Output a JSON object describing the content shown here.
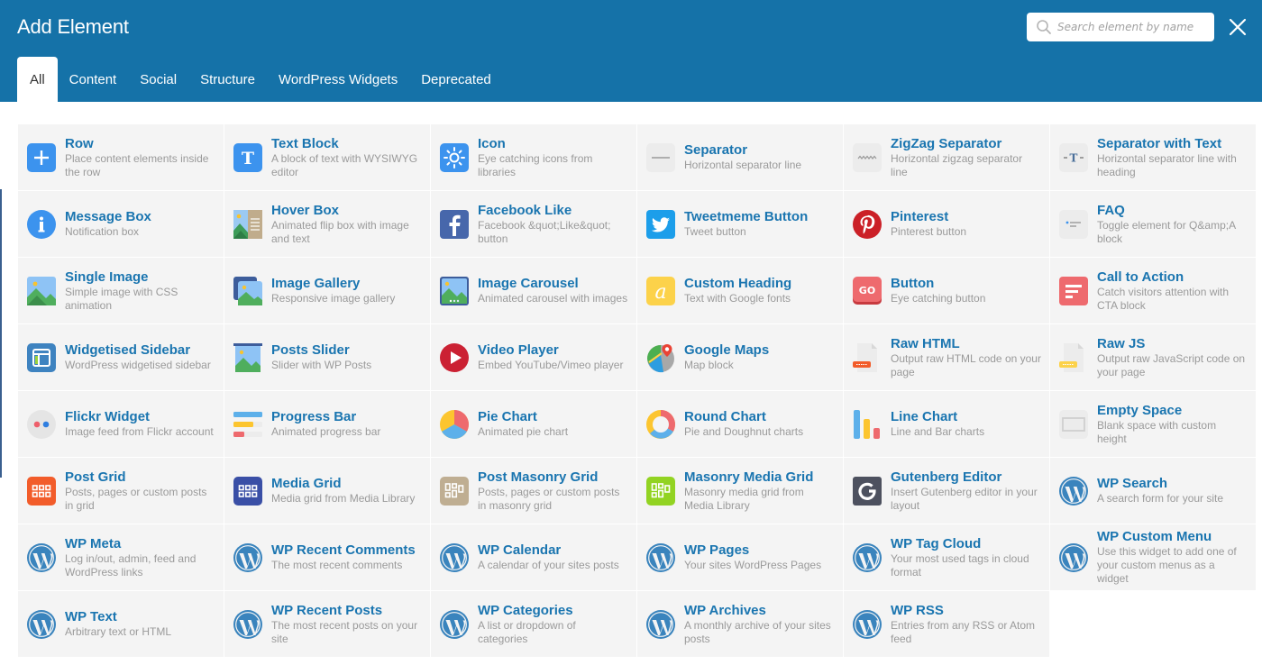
{
  "header": {
    "title": "Add Element",
    "search_placeholder": "Search element by name",
    "search_value": "",
    "search_icon": "search-icon",
    "close_icon": "close-icon"
  },
  "tabs": [
    {
      "label": "All",
      "active": true
    },
    {
      "label": "Content",
      "active": false
    },
    {
      "label": "Social",
      "active": false
    },
    {
      "label": "Structure",
      "active": false
    },
    {
      "label": "WordPress Widgets",
      "active": false
    },
    {
      "label": "Deprecated",
      "active": false
    }
  ],
  "colors": {
    "header_bg": "#1572a8",
    "title_text": "#1a75b0",
    "desc_text": "#9a9a9a",
    "cell_bg": "#f4f4f4"
  },
  "elements": [
    {
      "name": "Row",
      "desc": "Place content elements inside the row",
      "icon": "plus-icon"
    },
    {
      "name": "Text Block",
      "desc": "A block of text with WYSIWYG editor",
      "icon": "text-t-icon"
    },
    {
      "name": "Icon",
      "desc": "Eye catching icons from libraries",
      "icon": "sun-icon"
    },
    {
      "name": "Separator",
      "desc": "Horizontal separator line",
      "icon": "separator-icon"
    },
    {
      "name": "ZigZag Separator",
      "desc": "Horizontal zigzag separator line",
      "icon": "zigzag-icon"
    },
    {
      "name": "Separator with Text",
      "desc": "Horizontal separator line with heading",
      "icon": "separator-text-icon"
    },
    {
      "name": "Message Box",
      "desc": "Notification box",
      "icon": "info-icon"
    },
    {
      "name": "Hover Box",
      "desc": "Animated flip box with image and text",
      "icon": "hover-box-icon"
    },
    {
      "name": "Facebook Like",
      "desc": "Facebook &quot;Like&quot; button",
      "icon": "facebook-icon"
    },
    {
      "name": "Tweetmeme Button",
      "desc": "Tweet button",
      "icon": "twitter-icon"
    },
    {
      "name": "Pinterest",
      "desc": "Pinterest button",
      "icon": "pinterest-icon"
    },
    {
      "name": "FAQ",
      "desc": "Toggle element for Q&amp;A block",
      "icon": "faq-icon"
    },
    {
      "name": "Single Image",
      "desc": "Simple image with CSS animation",
      "icon": "image-icon"
    },
    {
      "name": "Image Gallery",
      "desc": "Responsive image gallery",
      "icon": "gallery-icon"
    },
    {
      "name": "Image Carousel",
      "desc": "Animated carousel with images",
      "icon": "carousel-icon"
    },
    {
      "name": "Custom Heading",
      "desc": "Text with Google fonts",
      "icon": "heading-a-icon"
    },
    {
      "name": "Button",
      "desc": "Eye catching button",
      "icon": "go-button-icon"
    },
    {
      "name": "Call to Action",
      "desc": "Catch visitors attention with CTA block",
      "icon": "cta-icon"
    },
    {
      "name": "Widgetised Sidebar",
      "desc": "WordPress widgetised sidebar",
      "icon": "sidebar-icon"
    },
    {
      "name": "Posts Slider",
      "desc": "Slider with WP Posts",
      "icon": "posts-slider-icon"
    },
    {
      "name": "Video Player",
      "desc": "Embed YouTube/Vimeo player",
      "icon": "play-icon"
    },
    {
      "name": "Google Maps",
      "desc": "Map block",
      "icon": "map-pin-icon"
    },
    {
      "name": "Raw HTML",
      "desc": "Output raw HTML code on your page",
      "icon": "raw-html-icon"
    },
    {
      "name": "Raw JS",
      "desc": "Output raw JavaScript code on your page",
      "icon": "raw-js-icon"
    },
    {
      "name": "Flickr Widget",
      "desc": "Image feed from Flickr account",
      "icon": "flickr-icon"
    },
    {
      "name": "Progress Bar",
      "desc": "Animated progress bar",
      "icon": "progress-bar-icon"
    },
    {
      "name": "Pie Chart",
      "desc": "Animated pie chart",
      "icon": "pie-chart-icon"
    },
    {
      "name": "Round Chart",
      "desc": "Pie and Doughnut charts",
      "icon": "doughnut-chart-icon"
    },
    {
      "name": "Line Chart",
      "desc": "Line and Bar charts",
      "icon": "bar-chart-icon"
    },
    {
      "name": "Empty Space",
      "desc": "Blank space with custom height",
      "icon": "empty-space-icon"
    },
    {
      "name": "Post Grid",
      "desc": "Posts, pages or custom posts in grid",
      "icon": "post-grid-icon"
    },
    {
      "name": "Media Grid",
      "desc": "Media grid from Media Library",
      "icon": "media-grid-icon"
    },
    {
      "name": "Post Masonry Grid",
      "desc": "Posts, pages or custom posts in masonry grid",
      "icon": "masonry-grid-icon"
    },
    {
      "name": "Masonry Media Grid",
      "desc": "Masonry media grid from Media Library",
      "icon": "masonry-media-icon"
    },
    {
      "name": "Gutenberg Editor",
      "desc": "Insert Gutenberg editor in your layout",
      "icon": "gutenberg-icon"
    },
    {
      "name": "WP Search",
      "desc": "A search form for your site",
      "icon": "wordpress-icon"
    },
    {
      "name": "WP Meta",
      "desc": "Log in/out, admin, feed and WordPress links",
      "icon": "wordpress-icon"
    },
    {
      "name": "WP Recent Comments",
      "desc": "The most recent comments",
      "icon": "wordpress-icon"
    },
    {
      "name": "WP Calendar",
      "desc": "A calendar of your sites posts",
      "icon": "wordpress-icon"
    },
    {
      "name": "WP Pages",
      "desc": "Your sites WordPress Pages",
      "icon": "wordpress-icon"
    },
    {
      "name": "WP Tag Cloud",
      "desc": "Your most used tags in cloud format",
      "icon": "wordpress-icon"
    },
    {
      "name": "WP Custom Menu",
      "desc": "Use this widget to add one of your custom menus as a widget",
      "icon": "wordpress-icon"
    },
    {
      "name": "WP Text",
      "desc": "Arbitrary text or HTML",
      "icon": "wordpress-icon"
    },
    {
      "name": "WP Recent Posts",
      "desc": "The most recent posts on your site",
      "icon": "wordpress-icon"
    },
    {
      "name": "WP Categories",
      "desc": "A list or dropdown of categories",
      "icon": "wordpress-icon"
    },
    {
      "name": "WP Archives",
      "desc": "A monthly archive of your sites posts",
      "icon": "wordpress-icon"
    },
    {
      "name": "WP RSS",
      "desc": "Entries from any RSS or Atom feed",
      "icon": "wordpress-icon"
    }
  ]
}
